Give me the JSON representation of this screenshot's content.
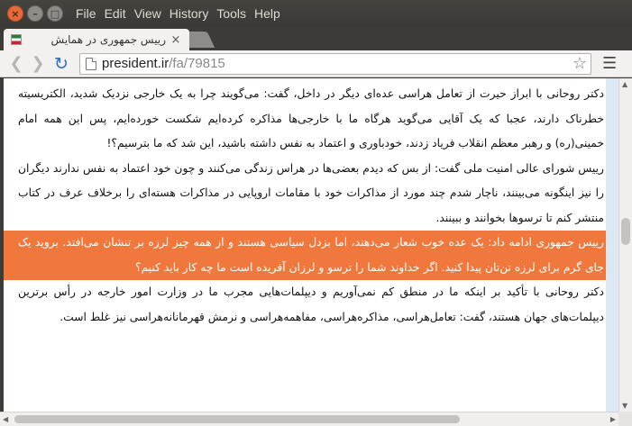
{
  "window": {
    "menu": [
      "File",
      "Edit",
      "View",
      "History",
      "Tools",
      "Help"
    ]
  },
  "tab": {
    "title": "رییس جمهوری در همایش",
    "close_glyph": "×"
  },
  "toolbar": {
    "url_host": "president.ir",
    "url_path": "/fa/79815"
  },
  "article": {
    "paragraphs": [
      "دکتر روحانی با ابراز حیرت از تعامل هراسی عده‌ای دیگر در داخل، گفت: می‌گویند چرا به یک خارجی نزدیک شدید، الکتریسیته خطرناک دارند، عجبا که یک آقایی می‌گوید هرگاه ما با خارجی‌ها مذاکره کرده‌ایم شکست خورده‌ایم، پس این همه امام خمینی(ره) و رهبر معظم انقلاب فریاد زدند، خودباوری و اعتماد به نفس داشته باشید، این شد که ما بترسیم؟!",
      "رییس شورای عالی امنیت ملی گفت: از بس که دیدم بعضی‌ها در هراس زندگی می‌کنند و چون خود اعتماد به نفس ندارند دیگران را نیز اینگونه می‌بینند، ناچار شدم چند مورد از مذاکرات خود با مقامات اروپایی در مذاکرات هسته‌ای را برخلاف عرف در کتاب منتشر کنم تا ترسوها بخوانند و ببینند.",
      "رییس جمهوری ادامه داد: یک عده خوب شعار می‌دهند، اما بزدل سیاسی هستند و از همه چیز لرزه بر تنشان می‌افتد. بروید یک جای گرم برای لرزه تن‌تان پیدا کنید. اگر خداوند شما را ترسو و لرزان آفریده است ما چه کار باید کنیم؟",
      "دکتر روحانی با تأکید بر اینکه ما در منطق کم نمی‌آوریم و دیپلمات‌هایی مجرب ما در وزارت امور خارجه در رأس برترین دیپلمات‌های جهان هستند، گفت: تعامل‌هراسی، مذاکره‌هراسی، مفاهمه‌هراسی و نرمش قهرمانانه‌هراسی نیز غلط است."
    ]
  }
}
